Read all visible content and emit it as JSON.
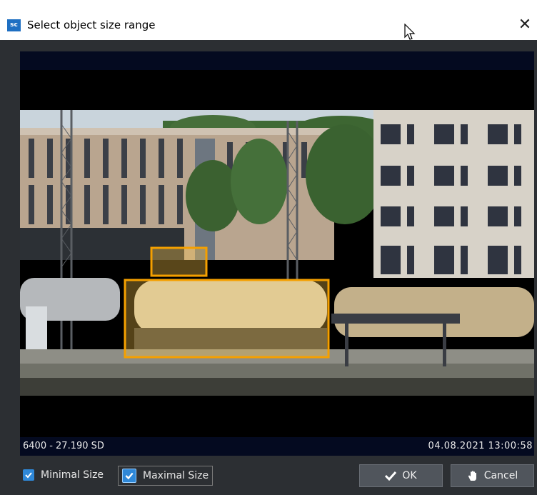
{
  "window": {
    "app_icon_text": "sc",
    "title": "Select object size range",
    "close_glyph": "✕"
  },
  "video": {
    "camera_label": "6400 - 27.190 SD",
    "timestamp": "04.08.2021 13:00:58"
  },
  "controls": {
    "minimal_size_label": "Minimal Size",
    "minimal_size_checked": true,
    "maximal_size_label": "Maximal Size",
    "maximal_size_checked": true,
    "ok_label": "OK",
    "cancel_label": "Cancel"
  },
  "icons": {
    "app": "app-logo-icon",
    "close": "close-icon",
    "ok": "checkmark-icon",
    "cancel": "hand-icon",
    "cursor": "mouse-pointer-icon"
  },
  "colors": {
    "size_box_stroke": "#f5a000",
    "size_box_fill": "#ffc84a",
    "checkbox": "#2f88d8",
    "client_bg": "#2c2f33",
    "app_icon": "#1e6fc2"
  }
}
